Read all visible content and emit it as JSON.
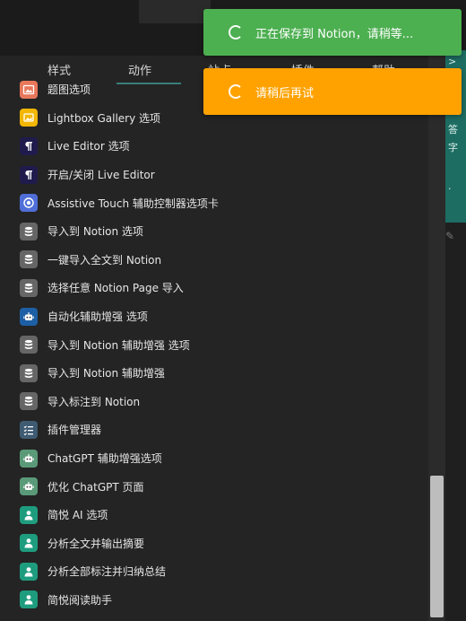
{
  "tabs": [
    "样式",
    "动作",
    "站点",
    "插件",
    "帮助"
  ],
  "items": [
    {
      "label": "题图选项",
      "icon": "image-icon",
      "color": "#e8785b"
    },
    {
      "label": "Lightbox Gallery 选项",
      "icon": "gallery-icon",
      "color": "#f2b705"
    },
    {
      "label": "Live Editor 选项",
      "icon": "pilcrow-icon",
      "color": "#1f1b4d"
    },
    {
      "label": "开启/关闭 Live Editor",
      "icon": "pilcrow-icon",
      "color": "#1f1b4d"
    },
    {
      "label": "Assistive Touch 辅助控制器选项卡",
      "icon": "assistive-touch-icon",
      "color": "#4f6ed8"
    },
    {
      "label": "导入到 Notion 选项",
      "icon": "database-icon",
      "color": "#666666"
    },
    {
      "label": "一键导入全文到 Notion",
      "icon": "database-icon",
      "color": "#666666"
    },
    {
      "label": "选择任意 Notion Page 导入",
      "icon": "database-icon",
      "color": "#666666"
    },
    {
      "label": "自动化辅助增强 选项",
      "icon": "robot-icon",
      "color": "#1d5fa5"
    },
    {
      "label": "导入到 Notion 辅助增强 选项",
      "icon": "database-icon",
      "color": "#666666"
    },
    {
      "label": "导入到 Notion 辅助增强",
      "icon": "database-icon",
      "color": "#666666"
    },
    {
      "label": "导入标注到 Notion",
      "icon": "database-icon",
      "color": "#666666"
    },
    {
      "label": "插件管理器",
      "icon": "list-check-icon",
      "color": "#3e5b72"
    },
    {
      "label": "ChatGPT 辅助增强选项",
      "icon": "robot-icon",
      "color": "#5a9a78"
    },
    {
      "label": "优化 ChatGPT 页面",
      "icon": "robot-icon",
      "color": "#5a9a78"
    },
    {
      "label": "简悦 AI 选项",
      "icon": "user-icon",
      "color": "#1e9c7e"
    },
    {
      "label": "分析全文并输出摘要",
      "icon": "user-icon",
      "color": "#1e9c7e"
    },
    {
      "label": "分析全部标注并归纳总结",
      "icon": "user-icon",
      "color": "#1e9c7e"
    },
    {
      "label": "简悦阅读助手",
      "icon": "user-icon",
      "color": "#1e9c7e"
    }
  ],
  "toasts": [
    {
      "message": "正在保存到 Notion，请稍等...",
      "color": "#4caf50"
    },
    {
      "message": "请稍后再试",
      "color": "#ffa200"
    }
  ],
  "right_panel": {
    "glyphs": [
      ">",
      "答",
      "字",
      "·"
    ]
  }
}
